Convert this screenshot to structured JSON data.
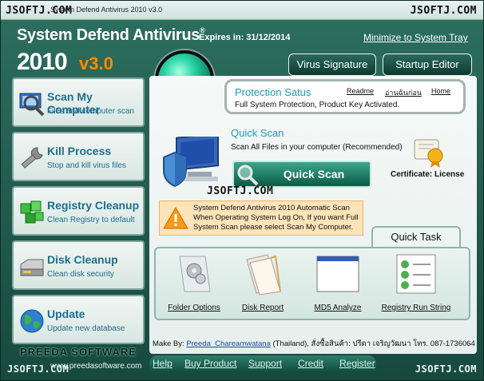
{
  "window": {
    "title": "System Defend Antivirus 2010 v3.0",
    "watermark": "JSOFTJ.COM"
  },
  "header": {
    "app_name": "System Defend Antivirus",
    "reg_mark": "®",
    "expires": "Expires in: 31/12/2014",
    "minimize": "Minimize to System Tray",
    "year": "2010",
    "version": "v3.0"
  },
  "top_buttons": {
    "virus_signature": "Virus Signature",
    "startup_editor": "Startup Editor"
  },
  "sidebar": {
    "items": [
      {
        "title": "Scan My Computer",
        "sub": "Files and computer scan",
        "icon": "magnifier-monitor-icon"
      },
      {
        "title": "Kill Process",
        "sub": "Stop and kill virus files",
        "icon": "wrench-icon"
      },
      {
        "title": "Registry Cleanup",
        "sub": "Clean Registry to default",
        "icon": "registry-cubes-icon"
      },
      {
        "title": "Disk Cleanup",
        "sub": "Clean disk security",
        "icon": "disk-drive-icon"
      },
      {
        "title": "Update",
        "sub": "Update new database",
        "icon": "globe-icon"
      }
    ]
  },
  "protection": {
    "title": "Protection Satus",
    "status": "Full System Protection, Product Key Activated.",
    "links": [
      "Readme",
      "อ่านฉันก่อน",
      "Home"
    ]
  },
  "quick_scan": {
    "title": "Quick Scan",
    "subtitle": "Scan All Files in your computer (Recommended)",
    "button": "Quick Scan"
  },
  "certificate": {
    "label": "Certificate: License"
  },
  "warning": {
    "text": "System Defend Antivirus 2010 Automatic Scan When Operating System Log On, If you want Full System Scan please select Scan My Computer."
  },
  "quick_task": {
    "tab": "Quick Task",
    "items": [
      "Folder Options",
      "Disk Report",
      "MD5 Analyze",
      "Registry Run String"
    ]
  },
  "footer": {
    "make_by_label": "Make By:",
    "author": "Preeda_Chareamwatana",
    "rest": " (Thailand), สั่งซื้อสินค้า: ปรีดา เจริญวัฒนา โทร. 087-1736064",
    "logo": "PREEDA SOFTWARE",
    "url": "www.preedasoftware.com",
    "nav": [
      "Help",
      "Buy Product",
      "Support",
      "Credit",
      "Register"
    ]
  },
  "colors": {
    "accent_teal": "#1b9bb8",
    "version_orange": "#ff8a00",
    "window_green": "#174a3e"
  }
}
